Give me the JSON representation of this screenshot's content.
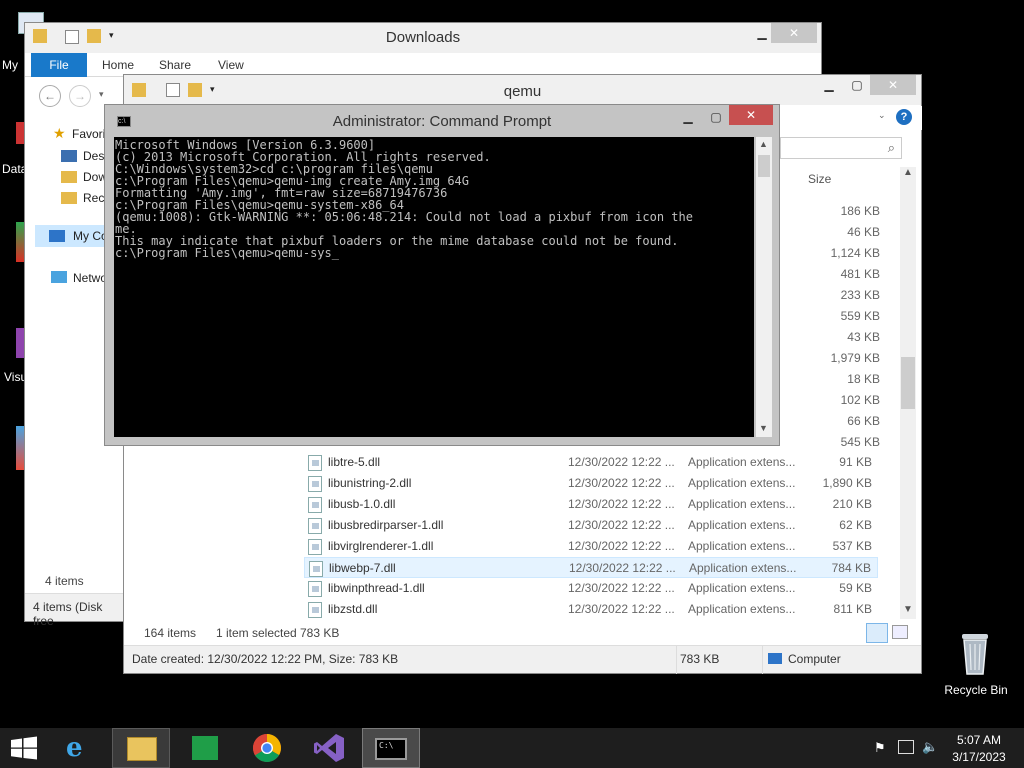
{
  "desktop": {
    "left_labels": [
      "My",
      "Data",
      "Visu"
    ],
    "recycle_bin": "Recycle Bin"
  },
  "downloads": {
    "title": "Downloads",
    "tabs": {
      "file": "File",
      "home": "Home",
      "share": "Share",
      "view": "View"
    },
    "nav": [
      "Favori",
      "Desk",
      "Dow",
      "Rece",
      "My Co",
      "Netwo"
    ],
    "items_count": "4 items",
    "status": "4 items (Disk free"
  },
  "qemu": {
    "title": "qemu",
    "size_header": "Size",
    "status_count": "164 items",
    "status_selected": "1 item selected",
    "status_size": "783 KB",
    "details": "Date created: 12/30/2022 12:22 PM, Size: 783 KB",
    "details_size": "783 KB",
    "details_location": "Computer",
    "hidden_sizes": [
      "186 KB",
      "46 KB",
      "1,124 KB",
      "481 KB",
      "233 KB",
      "559 KB",
      "43 KB",
      "1,979 KB",
      "18 KB",
      "102 KB",
      "66 KB",
      "545 KB"
    ],
    "files": [
      {
        "name": "libtre-5.dll",
        "date": "12/30/2022 12:22 ...",
        "type": "Application extens...",
        "size": "91 KB"
      },
      {
        "name": "libunistring-2.dll",
        "date": "12/30/2022 12:22 ...",
        "type": "Application extens...",
        "size": "1,890 KB"
      },
      {
        "name": "libusb-1.0.dll",
        "date": "12/30/2022 12:22 ...",
        "type": "Application extens...",
        "size": "210 KB"
      },
      {
        "name": "libusbredirparser-1.dll",
        "date": "12/30/2022 12:22 ...",
        "type": "Application extens...",
        "size": "62 KB"
      },
      {
        "name": "libvirglrenderer-1.dll",
        "date": "12/30/2022 12:22 ...",
        "type": "Application extens...",
        "size": "537 KB"
      },
      {
        "name": "libwebp-7.dll",
        "date": "12/30/2022 12:22 ...",
        "type": "Application extens...",
        "size": "784 KB"
      },
      {
        "name": "libwinpthread-1.dll",
        "date": "12/30/2022 12:22 ...",
        "type": "Application extens...",
        "size": "59 KB"
      },
      {
        "name": "libzstd.dll",
        "date": "12/30/2022 12:22 ...",
        "type": "Application extens...",
        "size": "811 KB"
      }
    ]
  },
  "cmd": {
    "title": "Administrator:  Command Prompt",
    "lines": [
      "Microsoft Windows [Version 6.3.9600]",
      "(c) 2013 Microsoft Corporation. All rights reserved.",
      "",
      "C:\\Windows\\system32>cd c:\\program files\\qemu",
      "",
      "c:\\Program Files\\qemu>qemu-img create Amy.img 64G",
      "Formatting 'Amy.img', fmt=raw size=68719476736",
      "",
      "c:\\Program Files\\qemu>qemu-system-x86_64",
      "",
      "(qemu:1008): Gtk-WARNING **: 05:06:48.214: Could not load a pixbuf from icon the",
      "me.",
      "This may indicate that pixbuf loaders or the mime database could not be found.",
      "",
      "c:\\Program Files\\qemu>qemu-sys_"
    ]
  },
  "taskbar": {
    "time": "5:07 AM",
    "date": "3/17/2023",
    "colors": {
      "bar": "#1e1e1e",
      "accent": "#1979ca"
    }
  }
}
